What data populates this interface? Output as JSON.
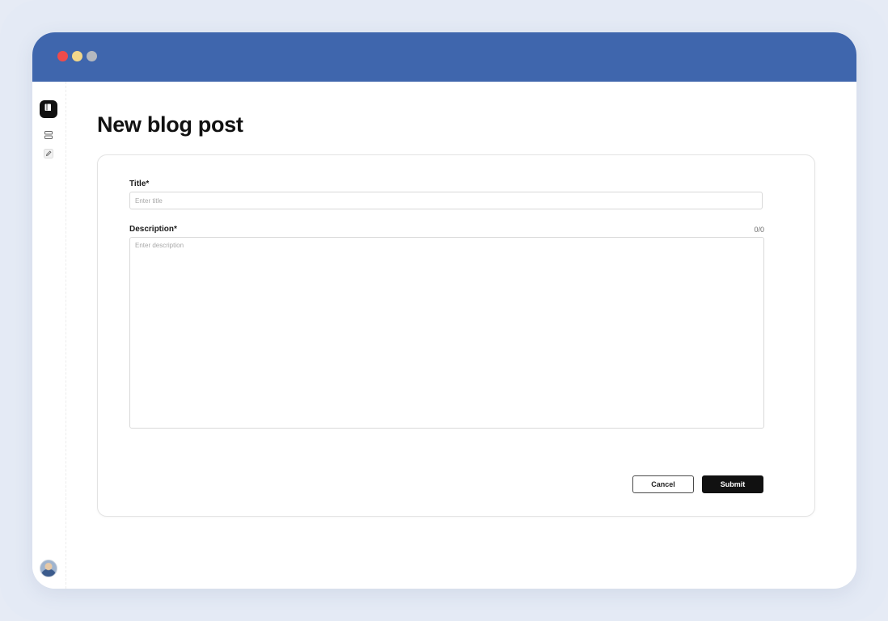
{
  "page": {
    "title": "New blog post"
  },
  "form": {
    "title_label": "Title*",
    "title_placeholder": "Enter title",
    "title_value": "",
    "description_label": "Description*",
    "description_placeholder": "Enter description",
    "description_value": "",
    "description_counter": "0/0"
  },
  "actions": {
    "cancel_label": "Cancel",
    "submit_label": "Submit"
  },
  "sidebar": {
    "items": [
      {
        "icon": "book-icon",
        "active": true
      },
      {
        "icon": "list-icon",
        "active": false
      },
      {
        "icon": "edit-icon",
        "active": false
      }
    ]
  },
  "colors": {
    "titlebar": "#3f66ad",
    "primary_button": "#111111",
    "window_close": "#ef4b4b",
    "window_minimize": "#f2d78a",
    "window_maximize": "#b4b8bf"
  }
}
